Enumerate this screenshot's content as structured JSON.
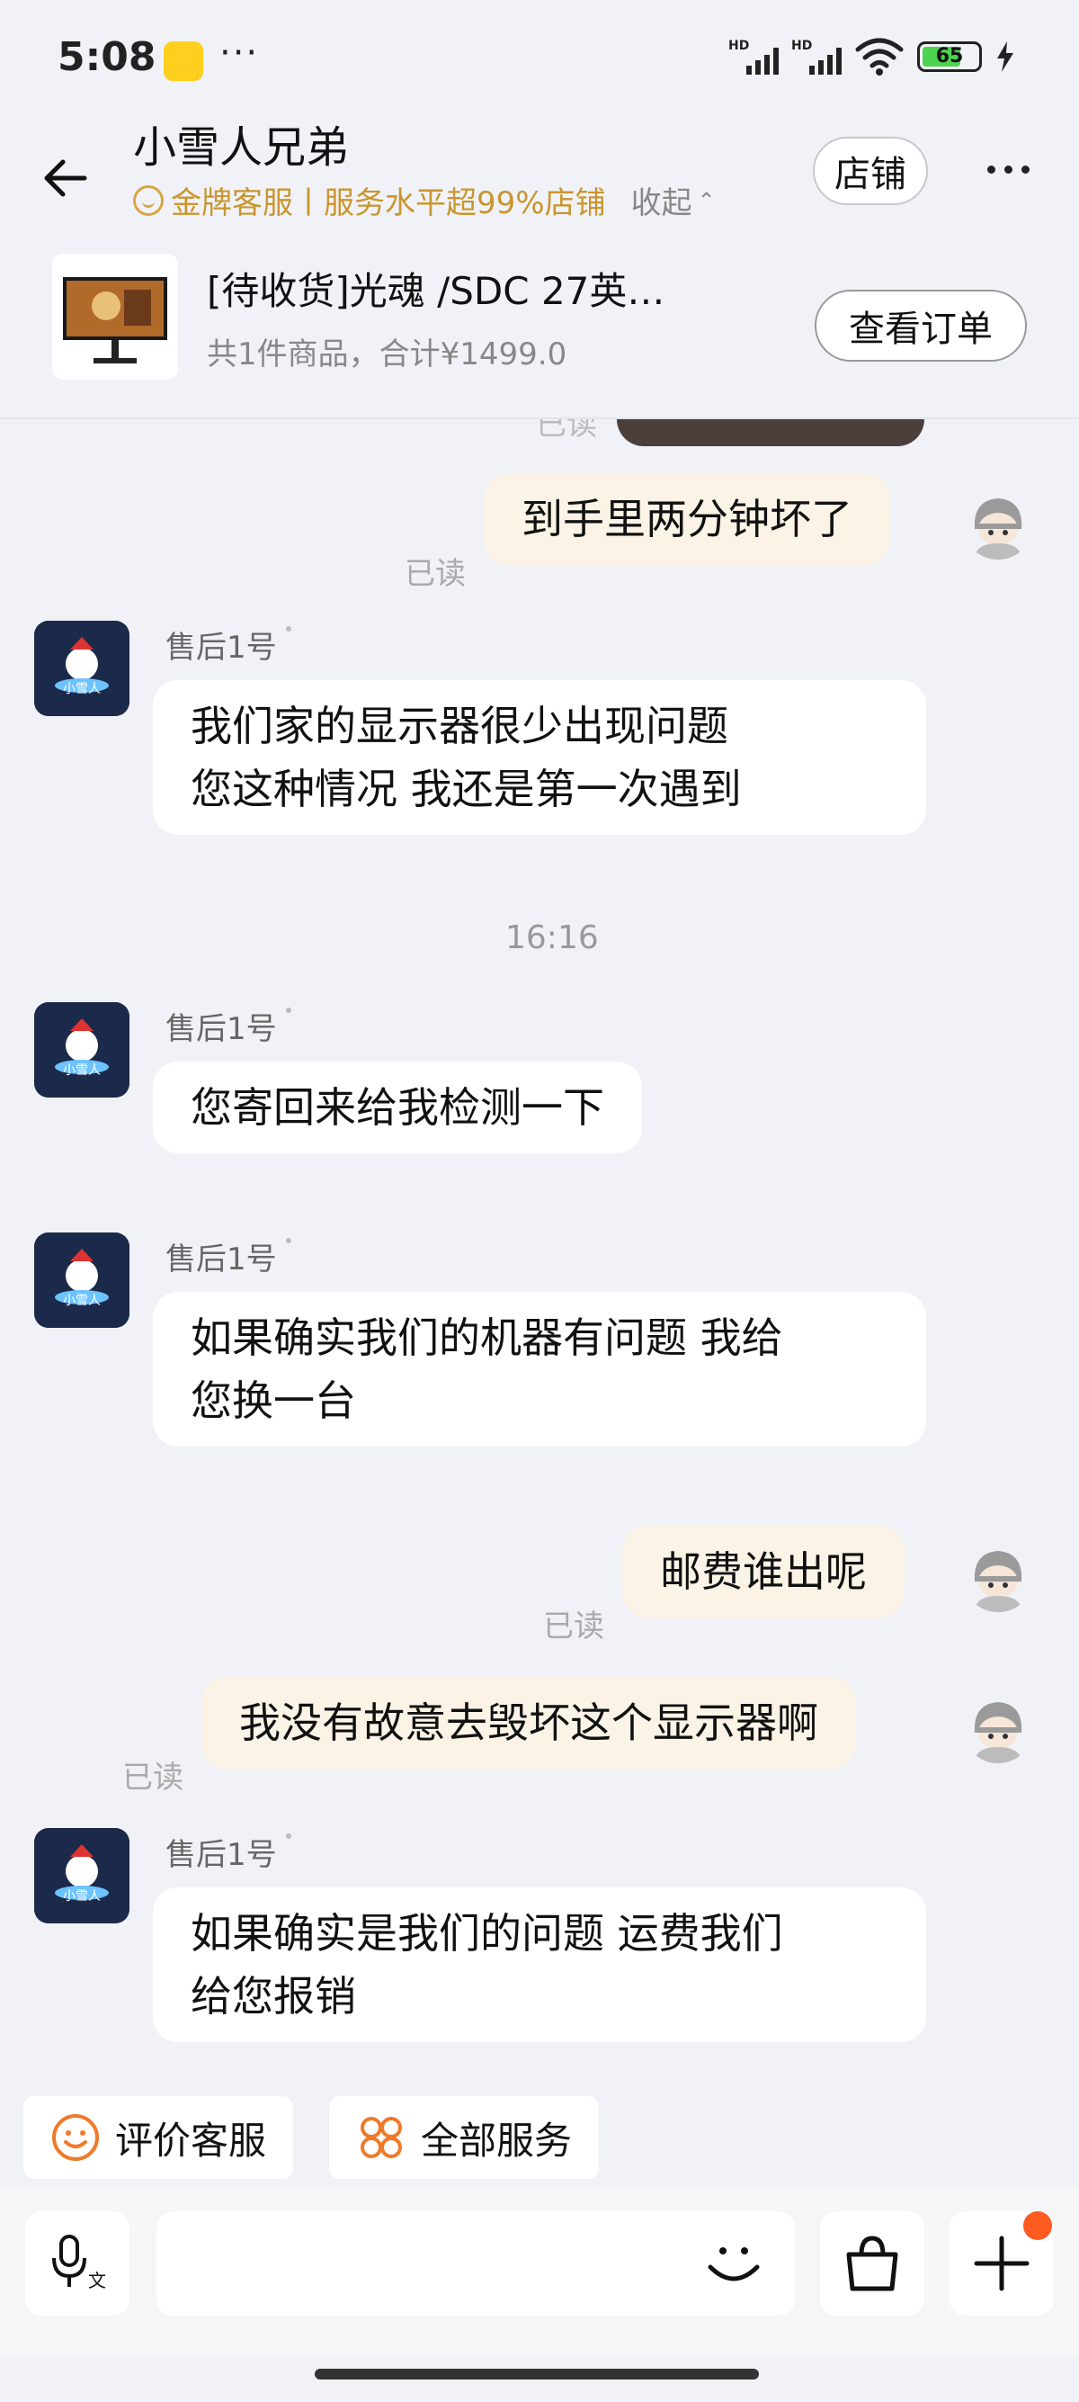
{
  "status_bar": {
    "time": "5:08",
    "dots": "···",
    "hd1": "HD",
    "hd2": "HD",
    "battery": "65"
  },
  "header": {
    "shop_name": "小雪人兄弟",
    "gold_badge": "金牌客服丨服务水平超99%店铺",
    "collapse": "收起",
    "shop_button": "店铺"
  },
  "order": {
    "title": "[待收货]光魂 /SDC 27英…",
    "summary": "共1件商品，合计¥1499.0",
    "view_button": "查看订单"
  },
  "chat": {
    "partial_read": "已读",
    "messages": [
      {
        "side": "out",
        "text": "到手里两分钟坏了",
        "read": "已读"
      },
      {
        "side": "in",
        "sender": "售后1号",
        "lines": [
          "我们家的显示器很少出现问题",
          "您这种情况 我还是第一次遇到"
        ]
      },
      {
        "timestamp": "16:16"
      },
      {
        "side": "in",
        "sender": "售后1号",
        "lines": [
          "您寄回来给我检测一下"
        ]
      },
      {
        "side": "in",
        "sender": "售后1号",
        "lines": [
          "如果确实我们的机器有问题 我给",
          "您换一台"
        ]
      },
      {
        "side": "out",
        "text": "邮费谁出呢",
        "read": "已读"
      },
      {
        "side": "out",
        "text": "我没有故意去毁坏这个显示器啊",
        "read": "已读"
      },
      {
        "side": "in",
        "sender": "售后1号",
        "lines": [
          "如果确实是我们的问题 运费我们",
          "给您报销"
        ]
      }
    ]
  },
  "quick_actions": {
    "rate": "评价客服",
    "all_services": "全部服务"
  },
  "input": {
    "placeholder": "",
    "voice_sub": "文"
  },
  "colors": {
    "gold": "#c9952e",
    "out_bubble": "#fbf3e6",
    "accent_orange": "#ff5a1f",
    "battery_green": "#4cd34f"
  }
}
